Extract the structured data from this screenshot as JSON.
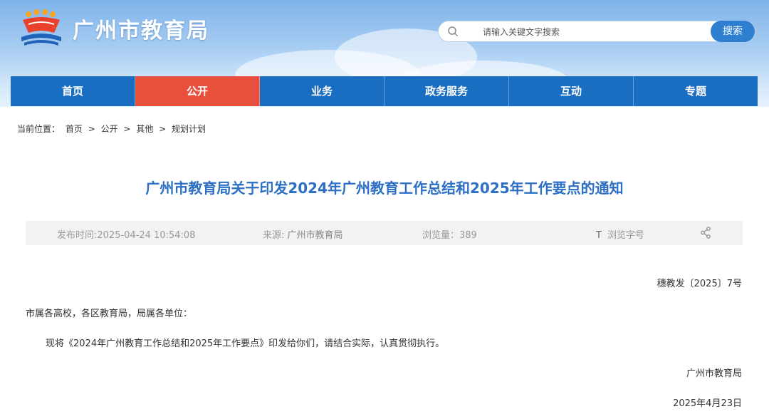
{
  "header": {
    "site_title": "广州市教育局",
    "search_placeholder": "请输入关键文字搜索",
    "search_button": "搜索"
  },
  "nav": {
    "items": [
      {
        "label": "首页",
        "active": false
      },
      {
        "label": "公开",
        "active": true
      },
      {
        "label": "业务",
        "active": false
      },
      {
        "label": "政务服务",
        "active": false
      },
      {
        "label": "互动",
        "active": false
      },
      {
        "label": "专题",
        "active": false
      }
    ]
  },
  "breadcrumb": {
    "prefix": "当前位置：",
    "items": [
      "首页",
      "公开",
      "其他",
      "规划计划"
    ],
    "separator": ">"
  },
  "article": {
    "title": "广州市教育局关于印发2024年广州教育工作总结和2025年工作要点的通知",
    "meta": {
      "publish_time": "发布时间:2025-04-24 10:54:08",
      "source_label": "来源:",
      "source_value": "广州市教育局",
      "views_label": "浏览量：",
      "views_value": "389",
      "font_size_icon": "T",
      "font_size_label": "浏览字号",
      "share_icon": "share-icon"
    },
    "doc_number": "穗教发〔2025〕7号",
    "addressee": "市属各高校，各区教育局，局属各单位：",
    "body": "现将《2024年广州教育工作总结和2025年工作要点》印发给你们，请结合实际，认真贯彻执行。",
    "signer": "广州市教育局",
    "date": "2025年4月23日"
  },
  "colors": {
    "nav_bg": "#1a6ec2",
    "nav_active": "#e84f3d",
    "title": "#2c6fc4",
    "search_button": "#2f7fd1"
  }
}
